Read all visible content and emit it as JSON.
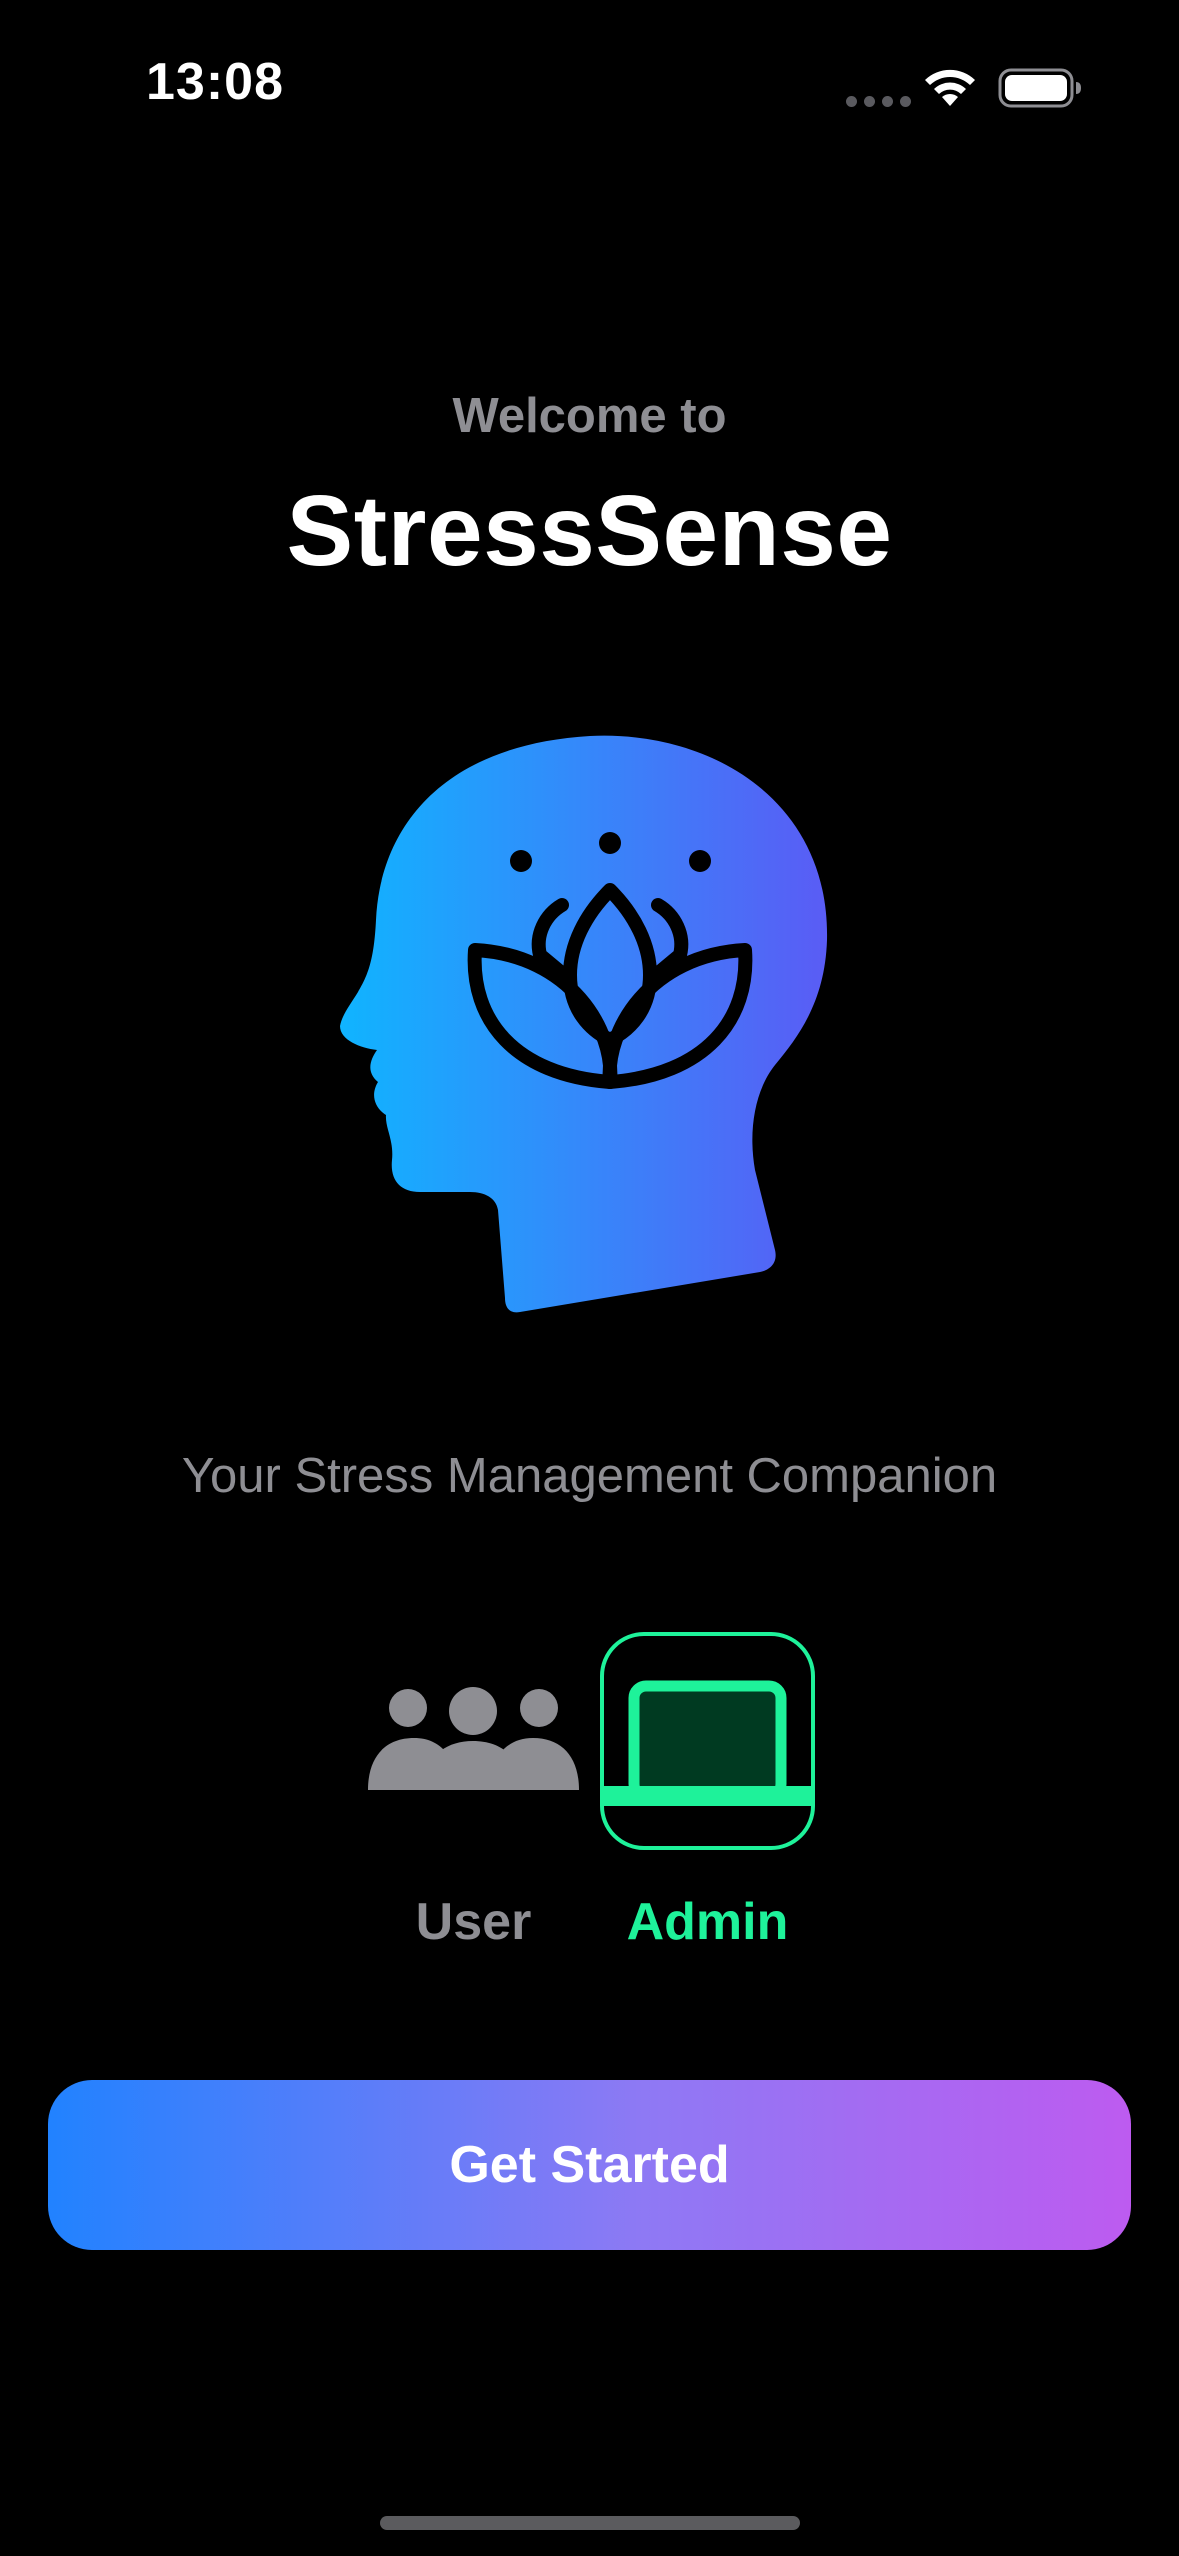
{
  "status_bar": {
    "time": "13:08",
    "icons": [
      "cellular-signal-icon",
      "wifi-icon",
      "battery-icon"
    ]
  },
  "welcome": {
    "subtitle": "Welcome to",
    "title": "StressSense",
    "hero_icon": "head-lotus-icon",
    "tagline": "Your Stress Management Companion"
  },
  "roles": {
    "options": [
      {
        "label": "User",
        "icon": "people-group-icon",
        "selected": false
      },
      {
        "label": "Admin",
        "icon": "laptop-icon",
        "selected": true
      }
    ]
  },
  "actions": {
    "get_started_label": "Get Started"
  },
  "colors": {
    "background": "#000000",
    "secondary_text": "#8e8e93",
    "selected_accent": "#1ef29a",
    "hero_gradient_start": "#10b4ff",
    "hero_gradient_end": "#5a5cf5",
    "button_gradient_start": "#2182ff",
    "button_gradient_end": "#bd5bf0"
  }
}
